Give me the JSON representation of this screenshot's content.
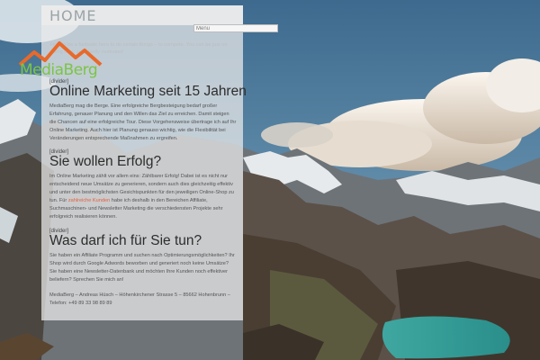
{
  "header": {
    "title": "HOME",
    "menu_placeholder": "Menu"
  },
  "site": {
    "logo_text": "MediaBerg",
    "tagline": "How to be a fantastic hero to do certain things – to compete. You can be just on doing chat, sufficiently motivated",
    "category_label": "Uncategorized"
  },
  "sections": [
    {
      "divider": "[divider]",
      "heading": "Online Marketing seit 15 Jahren",
      "text": "MediaBerg mag die Berge. Eine erfolgreiche Bergbesteigung bedarf großer Erfahrung, genauer Planung und den Willen das Ziel zu erreichen. Damit steigen die Chancen auf eine erfolgreiche Tour. Diese Vorgehensweise übertrage ich auf Ihr Online Marketing. Auch hier ist Planung genauso wichtig, wie die Flexibilität bei Veränderungen entsprechende Maßnahmen zu ergreifen."
    },
    {
      "divider": "[divider]",
      "heading": "Sie wollen Erfolg?",
      "text_before": "Im Online Marketing zählt vor allem eins: Zählbarer Erfolg! Dabei ist es nicht nur entscheidend neue Umsätze zu generieren, sondern auch dies gleichzeitig effektiv und unter den bestmöglichsten Gesichtspunkten für den jeweiligen Online-Shop zu tun. Für ",
      "link": "zahlreiche Kunden",
      "text_after": " habe ich deshalb in den Bereichen Affiliate, Suchmaschinen- und Newsletter Marketing die verschiedensten Projekte sehr erfolgreich realisieren können."
    },
    {
      "divider": "[divider]",
      "heading": "Was darf ich für Sie tun?",
      "text": "Sie haben ein Affiliate Programm und suchen nach Optimierungsmöglichkeiten? Ihr Shop wird durch Google Adwords beworben und generiert noch keine Umsätze? Sie haben eine Newsletter-Datenbank und möchten Ihre Kunden noch effektiver beliefern? Sprechen Sie mich an!"
    }
  ],
  "footer": {
    "text": "MediaBerg – Andreas Hüsch – Höhenkirchener Strasse 5 – 85662 Hohenbrunn – Telefon: +49 89 33 98 89 89"
  },
  "colors": {
    "logo_green": "#7cc447",
    "logo_orange": "#e8692a",
    "link": "#e4603f"
  }
}
